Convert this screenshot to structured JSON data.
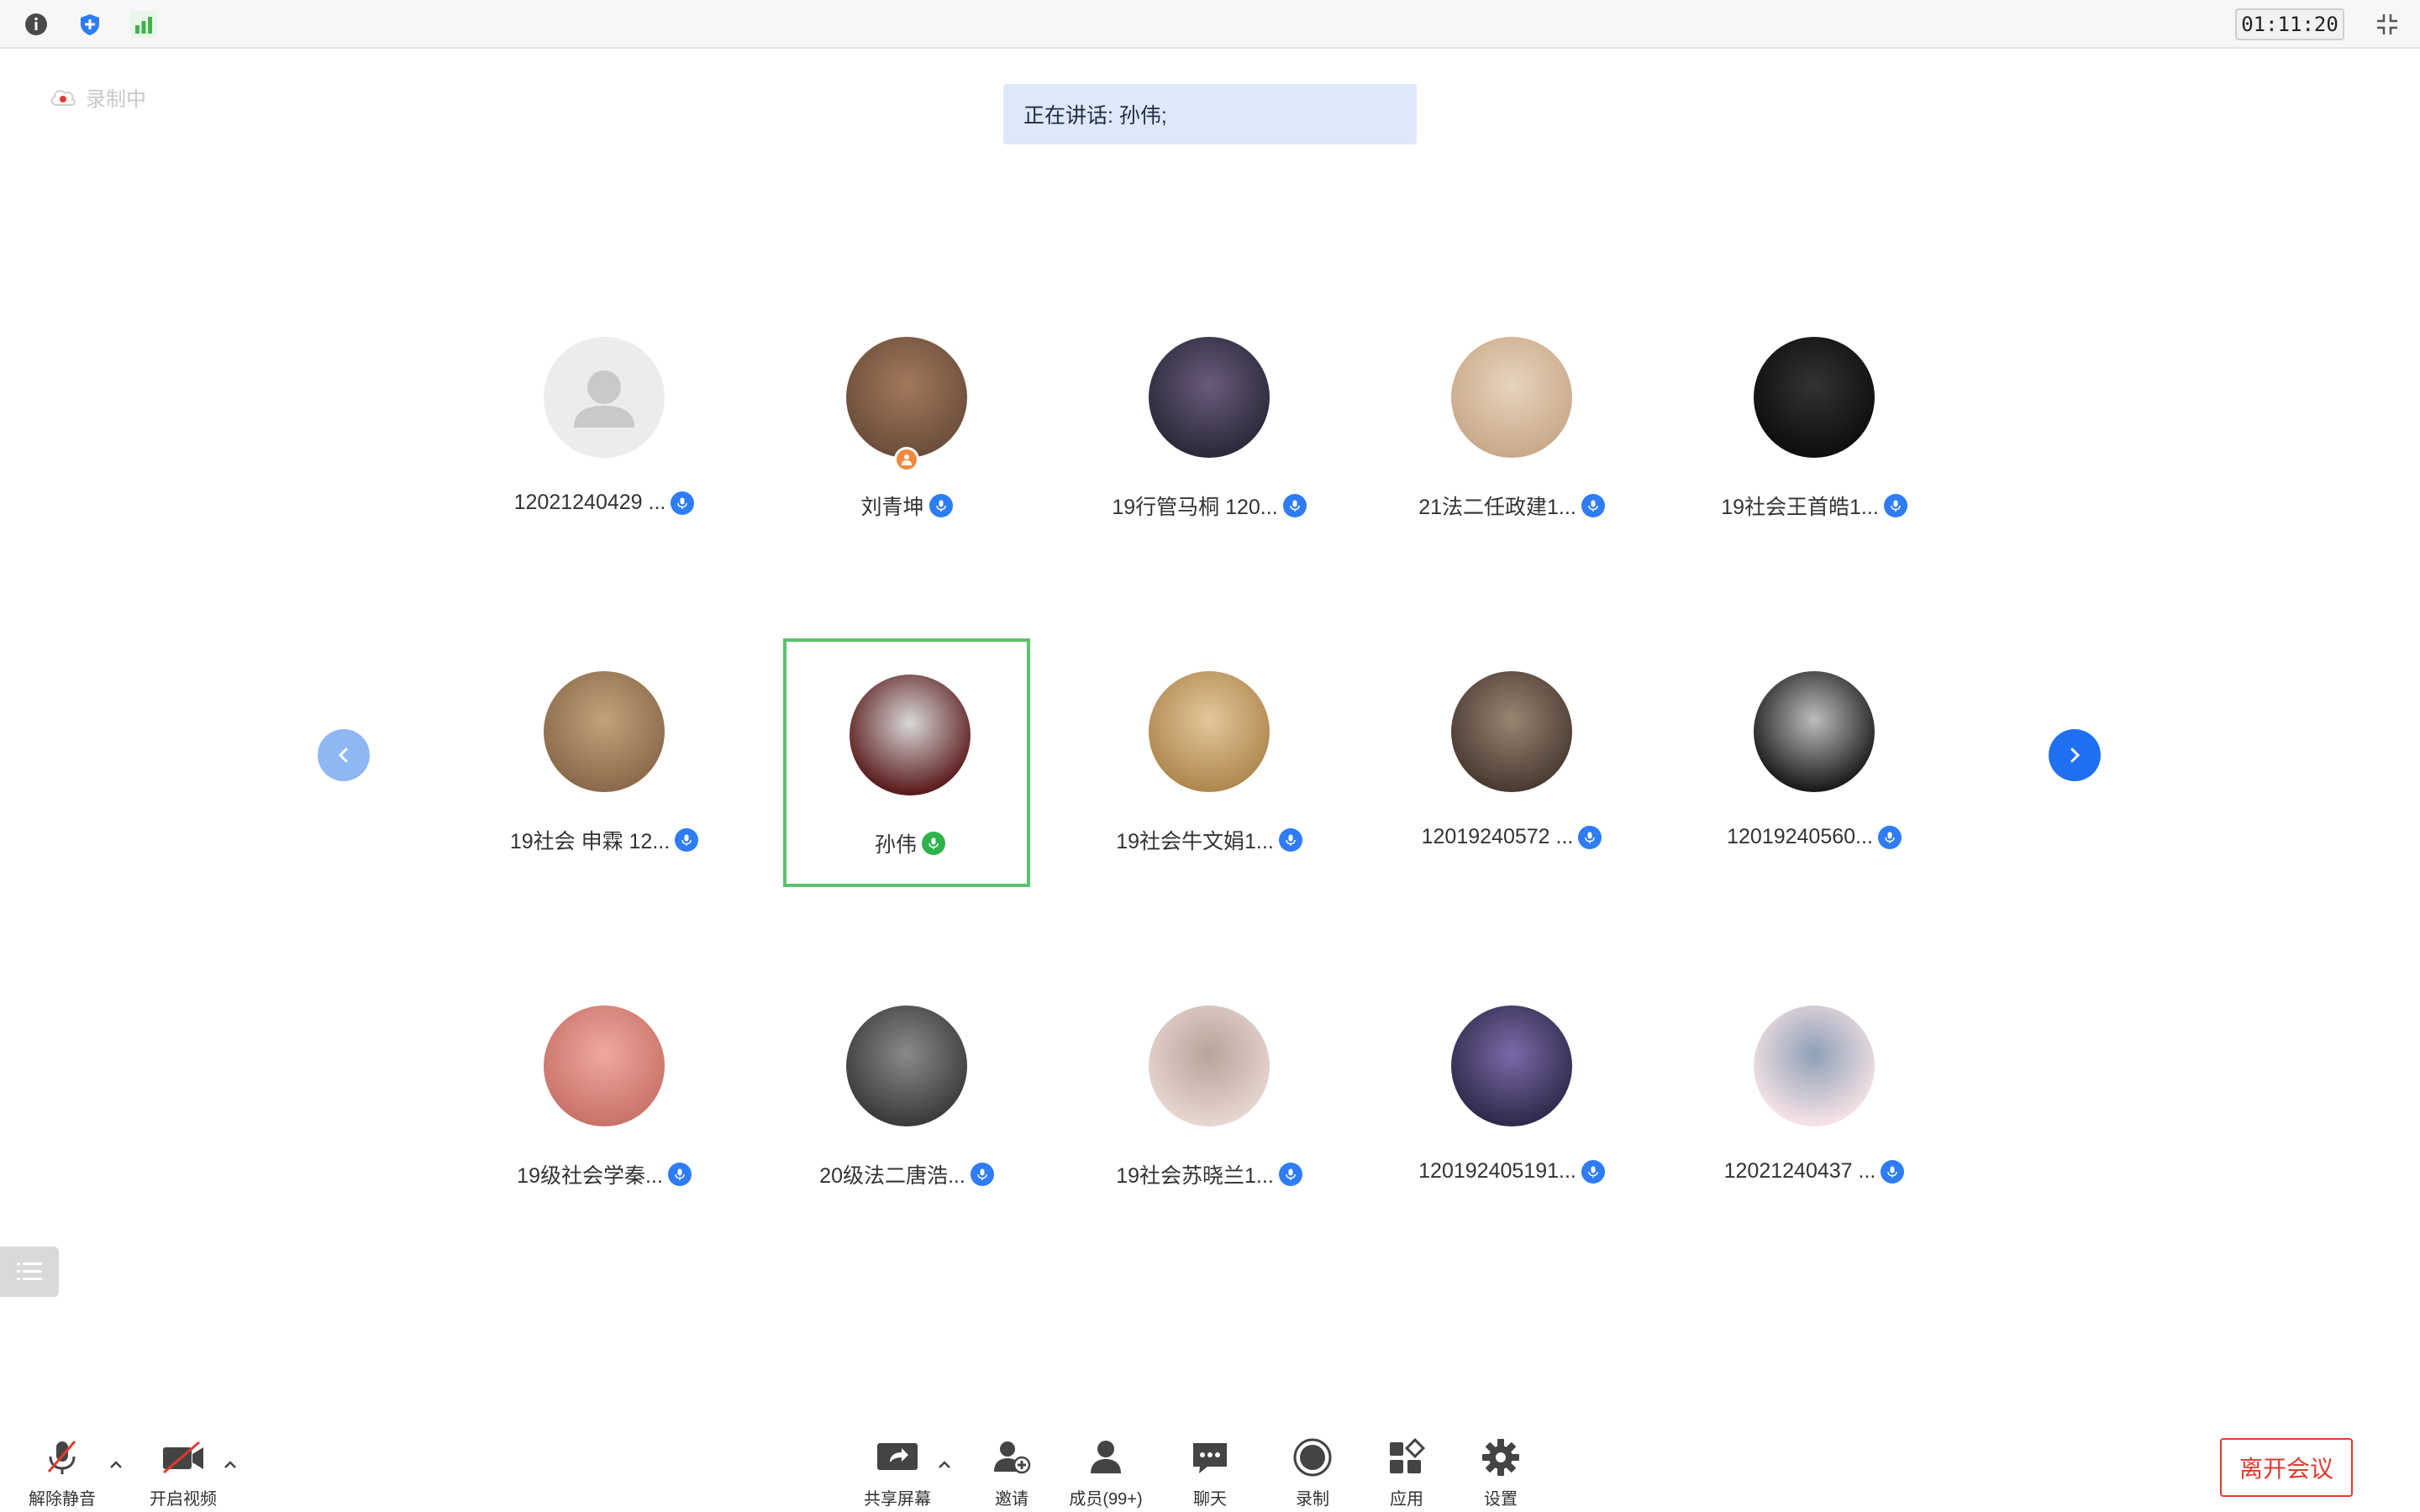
{
  "topbar": {
    "timer": "01:11:20",
    "icons": [
      "info-icon",
      "shield-icon",
      "signal-icon"
    ]
  },
  "recording": {
    "label": "录制中"
  },
  "speaking": {
    "text": "正在讲话: 孙伟;"
  },
  "participants": [
    {
      "name": "12021240429 ...",
      "avatar": "placeholder",
      "mic": "on"
    },
    {
      "name": "刘青坤",
      "avatar": "photo",
      "mic": "on",
      "host": true
    },
    {
      "name": "19行管马桐 120...",
      "avatar": "photo",
      "mic": "on"
    },
    {
      "name": "21法二任政建1...",
      "avatar": "photo",
      "mic": "on"
    },
    {
      "name": "19社会王首皓1...",
      "avatar": "photo",
      "mic": "on"
    },
    {
      "name": "19社会 申霖 12...",
      "avatar": "photo",
      "mic": "on"
    },
    {
      "name": "孙伟",
      "avatar": "photo",
      "mic": "speaking",
      "highlight": true
    },
    {
      "name": "19社会牛文娟1...",
      "avatar": "photo",
      "mic": "on"
    },
    {
      "name": "12019240572 ...",
      "avatar": "photo",
      "mic": "on"
    },
    {
      "name": "12019240560...",
      "avatar": "photo",
      "mic": "on"
    },
    {
      "name": "19级社会学秦...",
      "avatar": "photo",
      "mic": "on"
    },
    {
      "name": "20级法二唐浩...",
      "avatar": "photo",
      "mic": "on"
    },
    {
      "name": "19社会苏晓兰1...",
      "avatar": "photo",
      "mic": "on"
    },
    {
      "name": "120192405191...",
      "avatar": "photo",
      "mic": "on"
    },
    {
      "name": "12021240437 ...",
      "avatar": "photo",
      "mic": "on"
    }
  ],
  "toolbar": {
    "unmute": "解除静音",
    "start_video": "开启视频",
    "share_screen": "共享屏幕",
    "invite": "邀请",
    "members": "成员(99+)",
    "chat": "聊天",
    "record": "录制",
    "apps": "应用",
    "settings": "设置",
    "leave": "离开会议"
  },
  "colors": {
    "accent": "#1f6ff0",
    "speaking_bg": "#dde9fb",
    "highlight": "#5bc26b",
    "leave": "#e23a2e"
  }
}
